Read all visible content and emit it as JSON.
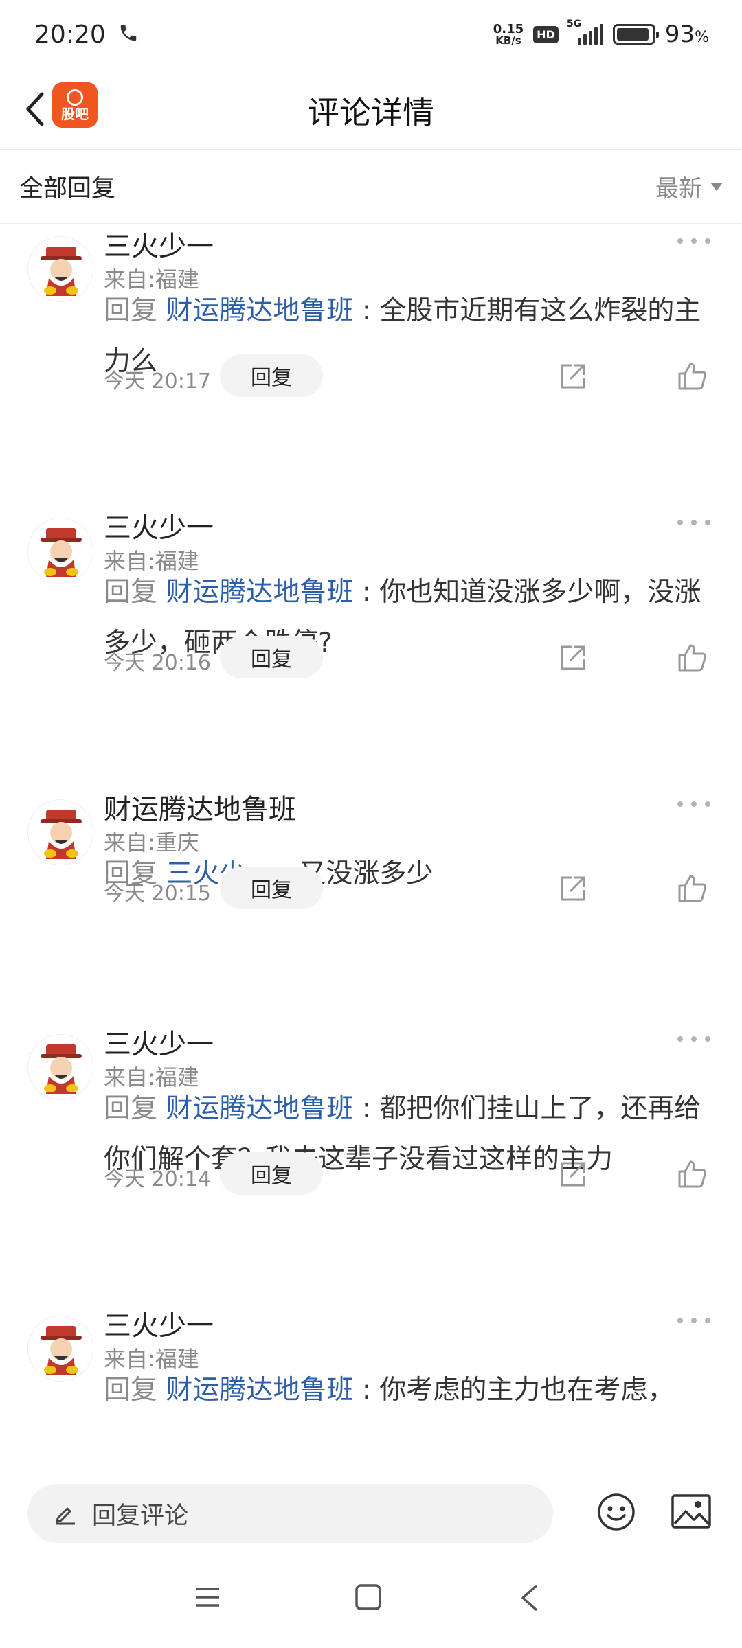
{
  "status_bar": {
    "time": "20:20",
    "net_speed_value": "0.15",
    "net_speed_unit": "KB/s",
    "hd_label": "HD",
    "network_label": "5G",
    "battery_percent": "93",
    "battery_sign": "%"
  },
  "header": {
    "logo_text": "股吧",
    "title": "评论详情"
  },
  "filter": {
    "label": "全部回复",
    "sort_label": "最新"
  },
  "comments": [
    {
      "username": "三火少一",
      "location": "来自:福建",
      "reply_prefix": "回复",
      "mention": "财运腾达地鲁班",
      "text": " : 全股市近期有这么炸裂的主力么",
      "time": "今天 20:17",
      "reply_label": "回复"
    },
    {
      "username": "三火少一",
      "location": "来自:福建",
      "reply_prefix": "回复",
      "mention": "财运腾达地鲁班",
      "text": " : 你也知道没涨多少啊，没涨多少，砸两个跌停?",
      "time": "今天 20:16",
      "reply_label": "回复"
    },
    {
      "username": "财运腾达地鲁班",
      "location": "来自:重庆",
      "reply_prefix": "回复",
      "mention": "三火少一",
      "text": " : 又没涨多少",
      "time": "今天 20:15",
      "reply_label": "回复"
    },
    {
      "username": "三火少一",
      "location": "来自:福建",
      "reply_prefix": "回复",
      "mention": "财运腾达地鲁班",
      "text": " : 都把你们挂山上了，还再给你们解个套？我去这辈子没看过这样的主力",
      "time": "今天 20:14",
      "reply_label": "回复"
    },
    {
      "username": "三火少一",
      "location": "来自:福建",
      "reply_prefix": "回复",
      "mention": "财运腾达地鲁班",
      "text": " : 你考虑的主力也在考虑，",
      "time": "",
      "reply_label": ""
    }
  ],
  "input_bar": {
    "placeholder": "回复评论"
  },
  "colors": {
    "brand": "#f0561f",
    "mention": "#2d5fa8",
    "muted": "#8a8a8a"
  },
  "icons": {
    "back": "chevron-left-icon",
    "more": "more-dots-icon",
    "share": "share-icon",
    "like": "thumbs-up-icon",
    "edit": "pencil-icon",
    "emoji": "smiley-icon",
    "image": "image-icon",
    "phone": "phone-icon"
  }
}
